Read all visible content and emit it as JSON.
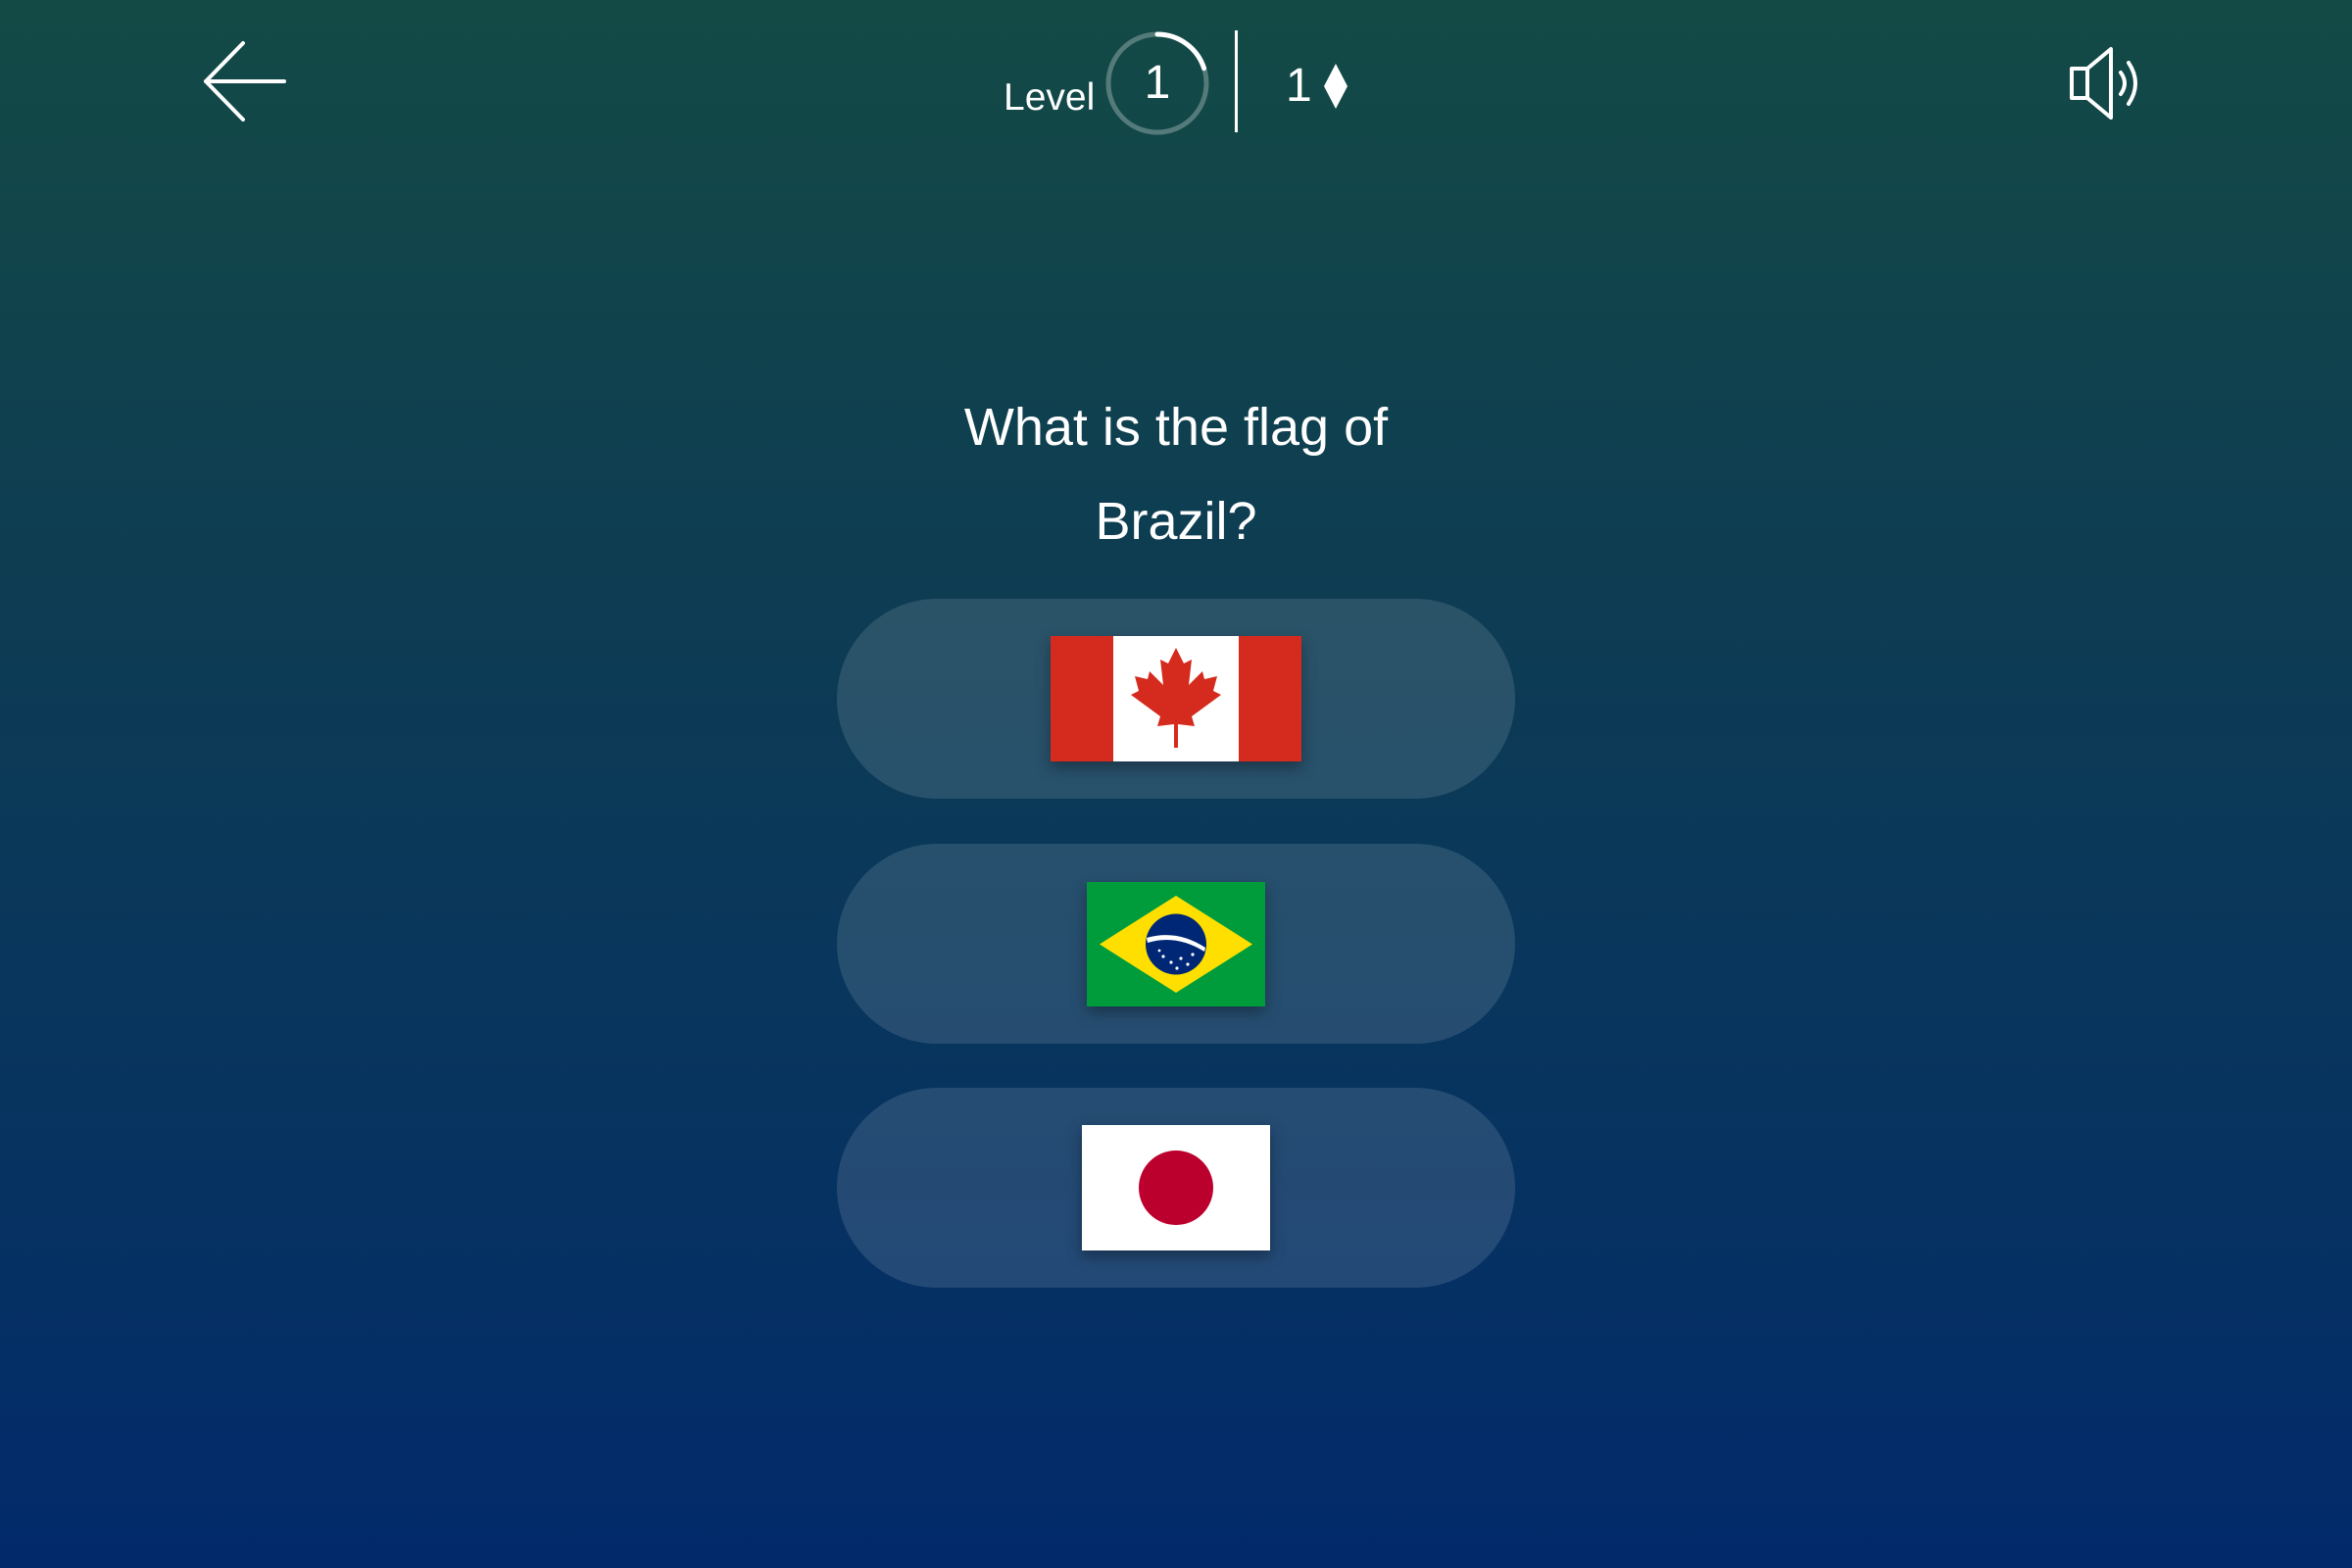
{
  "header": {
    "back_icon": "arrow-left-icon",
    "level_label": "Level",
    "level_number": "1",
    "level_progress": 0.2,
    "gems_count": "1",
    "gem_icon": "diamond-icon",
    "sound_icon": "speaker-icon"
  },
  "question": {
    "line1": "What is the flag of",
    "line2": "Brazil?"
  },
  "options": [
    {
      "flag": "Canada",
      "icon": "canada-flag-icon"
    },
    {
      "flag": "Brazil",
      "icon": "brazil-flag-icon"
    },
    {
      "flag": "Japan",
      "icon": "japan-flag-icon"
    }
  ],
  "colors": {
    "background_top": "#134a45",
    "background_bottom": "#022a6b",
    "canada_red": "#d52b1e",
    "brazil_green": "#009c3b",
    "brazil_yellow": "#ffdf00",
    "brazil_blue": "#002776",
    "japan_red": "#bc002d"
  }
}
